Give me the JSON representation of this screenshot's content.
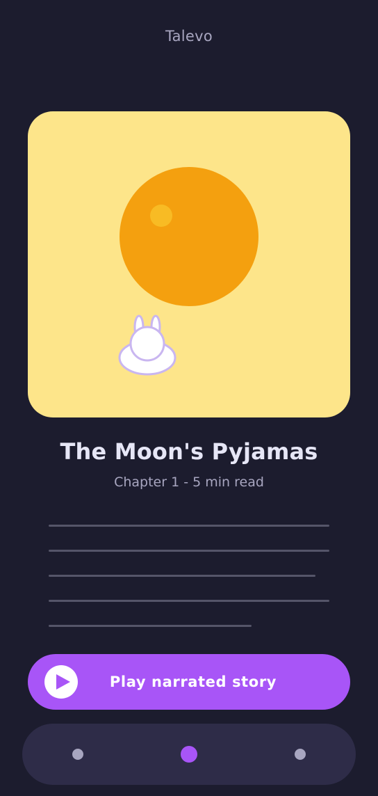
{
  "app": {
    "title": "Talevo"
  },
  "cover": {
    "illustration": "moon-with-bunny-illustration",
    "colors": {
      "background": "#fde58a",
      "moon": "#f4a00f",
      "moon_crater": "#f8bb24",
      "bunny_body": "#ffffff",
      "bunny_outline": "#c9b6f0"
    }
  },
  "story": {
    "title": "The Moon's Pyjamas",
    "meta": "Chapter 1 - 5 min read"
  },
  "text_preview": {
    "line_count": 5,
    "line_color": "#555569"
  },
  "play_button": {
    "label": "Play narrated story",
    "icon": "play-icon",
    "color": "#a855f7"
  },
  "pager": {
    "dot_count": 3,
    "active_index": 1,
    "active_color": "#a855f7",
    "inactive_color": "#a8a6c0"
  }
}
